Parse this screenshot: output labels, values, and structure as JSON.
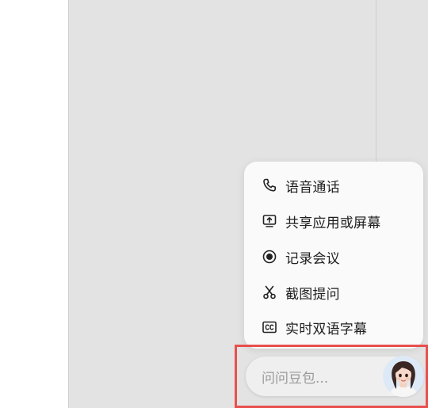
{
  "menu": {
    "items": [
      {
        "label": "语音通话",
        "icon": "phone-icon"
      },
      {
        "label": "共享应用或屏幕",
        "icon": "share-screen-icon"
      },
      {
        "label": "记录会议",
        "icon": "record-icon"
      },
      {
        "label": "截图提问",
        "icon": "scissors-icon"
      },
      {
        "label": "实时双语字幕",
        "icon": "cc-icon"
      }
    ]
  },
  "assistant": {
    "placeholder": "问问豆包...",
    "avatar": "assistant-avatar"
  },
  "colors": {
    "panel_bg": "#e3e3e3",
    "menu_bg": "#fafafa",
    "highlight": "#e8504d",
    "text": "#1f1f1f",
    "placeholder": "#9a9a9a"
  }
}
